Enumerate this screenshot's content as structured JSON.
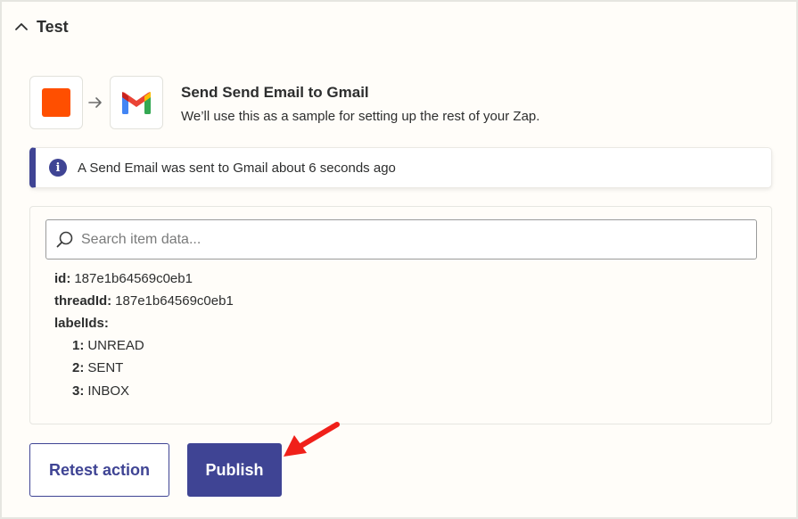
{
  "section": {
    "title": "Test",
    "collapse_icon": "chevron-up-icon"
  },
  "step": {
    "trigger_app_icon": "orange-square-icon",
    "action_app_icon": "gmail-icon",
    "connector_icon": "arrow-right-icon",
    "title": "Send Send Email to Gmail",
    "subtitle": "We’ll use this as a sample for setting up the rest of your Zap."
  },
  "alert": {
    "icon": "info-icon",
    "glyph": "i",
    "message": "A Send Email was sent to Gmail about 6 seconds ago"
  },
  "search": {
    "icon": "search-icon",
    "placeholder": "Search item data...",
    "value": ""
  },
  "item_data": {
    "fields": [
      {
        "key": "id:",
        "value": "187e1b64569c0eb1"
      },
      {
        "key": "threadId:",
        "value": "187e1b64569c0eb1"
      },
      {
        "key": "labelIds:",
        "value": ""
      }
    ],
    "label_ids": [
      {
        "key": "1:",
        "value": "UNREAD"
      },
      {
        "key": "2:",
        "value": "SENT"
      },
      {
        "key": "3:",
        "value": "INBOX"
      }
    ]
  },
  "buttons": {
    "retest_label": "Retest action",
    "publish_label": "Publish"
  },
  "annotation": {
    "icon": "red-arrow-icon",
    "color": "#f0201a"
  },
  "colors": {
    "brand": "#3f4494",
    "zapier_orange": "#ff4f00",
    "annotation_red": "#f0201a"
  }
}
